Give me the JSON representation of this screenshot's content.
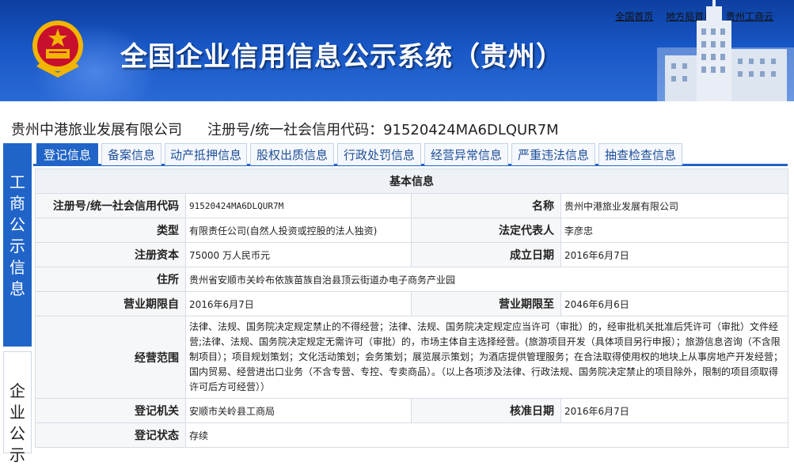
{
  "header": {
    "title": "全国企业信用信息公示系统（贵州）",
    "links": [
      "全国首页",
      "地方局首页",
      "贵州工商云"
    ]
  },
  "company": {
    "name": "贵州中港旅业发展有限公司",
    "regno_text": "注册号/统一社会信用代码：91520424MA6DLQUR7M"
  },
  "side_tabs": {
    "gongshang": [
      "工",
      "商",
      "公",
      "示",
      "信",
      "息"
    ],
    "qiye": [
      "企",
      "业",
      "公",
      "示"
    ]
  },
  "tabs": [
    "登记信息",
    "备案信息",
    "动产抵押信息",
    "股权出质信息",
    "行政处罚信息",
    "经营异常信息",
    "严重违法信息",
    "抽查检查信息"
  ],
  "basic": {
    "section_title": "基本信息",
    "regno_label": "注册号/统一社会信用代码",
    "regno": "91520424MA6DLQUR7M",
    "name_label": "名称",
    "name": "贵州中港旅业发展有限公司",
    "type_label": "类型",
    "type": "有限责任公司(自然人投资或控股的法人独资)",
    "legal_label": "法定代表人",
    "legal": "李彦忠",
    "capital_label": "注册资本",
    "capital": "75000 万人民币元",
    "established_label": "成立日期",
    "established": "2016年6月7日",
    "address_label": "住所",
    "address": "贵州省安顺市关岭布依族苗族自治县顶云街道办电子商务产业园",
    "term_from_label": "营业期限自",
    "term_from": "2016年6月7日",
    "term_to_label": "营业期限至",
    "term_to": "2046年6月6日",
    "scope_label": "经营范围",
    "scope": "法律、法规、国务院决定规定禁止的不得经营；法律、法规、国务院决定规定应当许可（审批）的，经审批机关批准后凭许可（审批）文件经营;法律、法规、国务院决定规定无需许可（审批）的，市场主体自主选择经营。(旅游项目开发（具体项目另行申报）；旅游信息咨询（不含限制项目）；项目规划策划；文化活动策划；会务策划；展览展示策划；为酒店提供管理服务；在合法取得使用权的地块上从事房地产开发经营；国内贸易、经营进出口业务（不含专营、专控、专卖商品）。（以上各项涉及法律、行政法规、国务院决定禁止的项目除外，限制的项目须取得许可后方可经营））",
    "authority_label": "登记机关",
    "authority": "安顺市关岭县工商局",
    "approval_label": "核准日期",
    "approval": "2016年6月7日",
    "status_label": "登记状态",
    "status": "存续"
  },
  "colors": {
    "header_blue": "#1756c4",
    "tab_blue": "#2064c8",
    "label_bg": "#f6f7f9"
  }
}
